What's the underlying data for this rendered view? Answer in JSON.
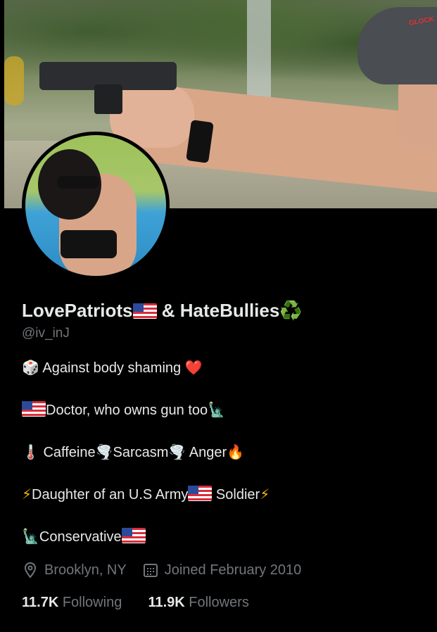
{
  "profile": {
    "name_part1": "LovePatriots",
    "name_amp": " & HateBullies",
    "recycle_emoji": "♻️",
    "handle": "@iv_inJ"
  },
  "bio": {
    "line1": {
      "emoji": "🎲",
      "text": " Against body shaming ",
      "heart": "❤️"
    },
    "line2": {
      "text": "Doctor, who owns gun too",
      "emoji": "🗽"
    },
    "line3": {
      "therm": "🌡️",
      "t1": " Caffeine",
      "tornado": "🌪️",
      "t2": "Sarcasm",
      "t3": " Anger",
      "fire": "🔥"
    },
    "line4": {
      "bolt": "⚡",
      "t1": "Daughter of an U.S Army",
      "t2": " Soldier"
    },
    "line5": {
      "emoji": "🗽",
      "text": "Conservative"
    }
  },
  "meta": {
    "location": "Brooklyn, NY",
    "joined": "Joined February 2010",
    "location_icon": "location-pin-icon",
    "calendar_icon": "calendar-icon"
  },
  "stats": {
    "following_count": "11.7K",
    "following_label": "Following",
    "followers_count": "11.9K",
    "followers_label": "Followers"
  },
  "banner_text": {
    "cap_logo": "GLOCK"
  }
}
